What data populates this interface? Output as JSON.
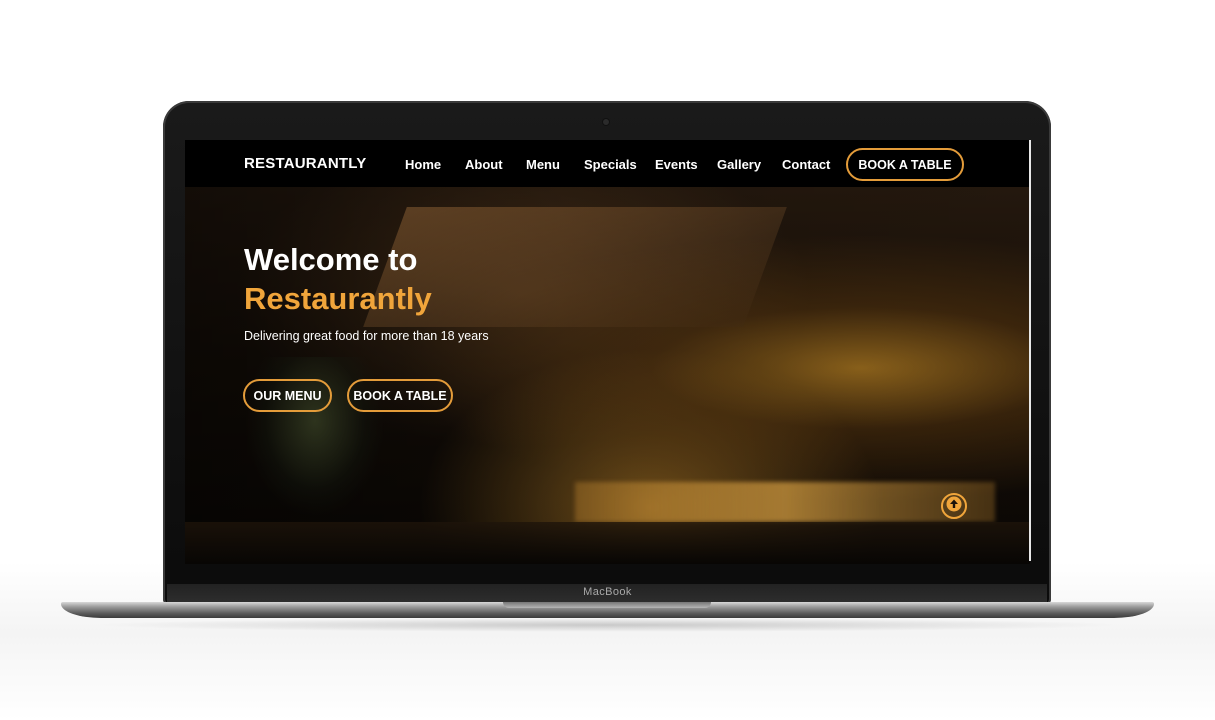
{
  "device": {
    "label": "MacBook"
  },
  "header": {
    "logo": "RESTAURANTLY",
    "nav": [
      "Home",
      "About",
      "Menu",
      "Specials",
      "Events",
      "Gallery",
      "Contact"
    ],
    "cta": "BOOK A TABLE"
  },
  "hero": {
    "title_line1": "Welcome to",
    "title_line2": "Restaurantly",
    "subtitle": "Delivering great food for more than 18 years",
    "buttons": [
      "OUR MENU",
      "BOOK A TABLE"
    ]
  },
  "back_to_top": {
    "icon": "arrow-up-circle-icon"
  },
  "colors": {
    "accent": "#f0a53b",
    "nav_bg": "#000000",
    "text": "#ffffff"
  }
}
